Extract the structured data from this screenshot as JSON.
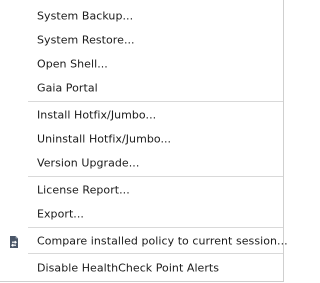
{
  "menu": {
    "items": [
      {
        "label": "System Backup..."
      },
      {
        "label": "System Restore..."
      },
      {
        "label": "Open Shell..."
      },
      {
        "label": "Gaia Portal"
      },
      {
        "label": "Install Hotfix/Jumbo..."
      },
      {
        "label": "Uninstall Hotfix/Jumbo..."
      },
      {
        "label": "Version Upgrade..."
      },
      {
        "label": "License Report..."
      },
      {
        "label": "Export..."
      },
      {
        "label": "Compare installed policy to current session...",
        "icon": "compare-policy-icon"
      },
      {
        "label": "Disable HealthCheck Point Alerts"
      }
    ]
  }
}
